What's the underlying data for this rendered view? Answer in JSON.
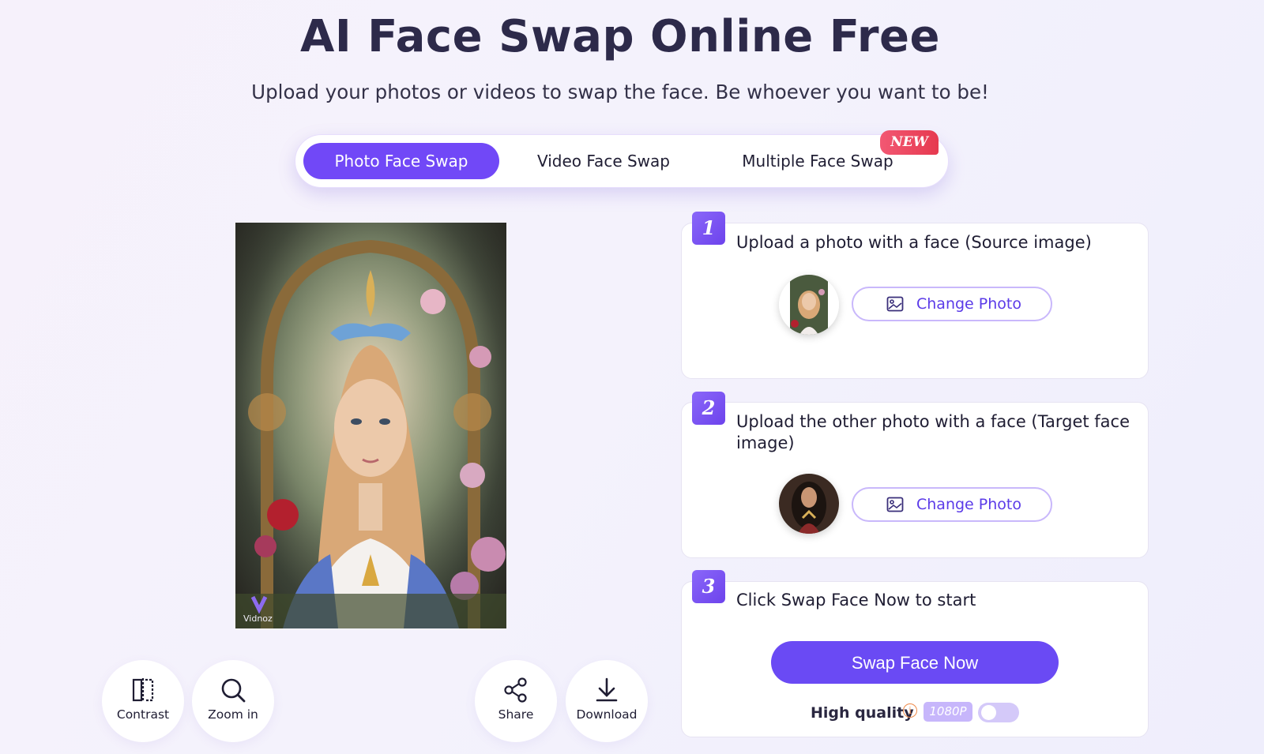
{
  "page": {
    "title": "AI Face Swap Online Free",
    "subtitle": "Upload your photos or videos to swap the face. Be whoever you want to be!"
  },
  "tabs": [
    {
      "label": "Photo Face Swap",
      "active": true
    },
    {
      "label": "Video Face Swap",
      "active": false
    },
    {
      "label": "Multiple Face Swap",
      "active": false
    }
  ],
  "new_badge": "NEW",
  "preview": {
    "watermark": "Vidnoz"
  },
  "tools": {
    "contrast": "Contrast",
    "zoom": "Zoom in",
    "share": "Share",
    "download": "Download"
  },
  "steps": [
    {
      "number": "1",
      "text": "Upload a photo with a face (Source image)",
      "button": "Change Photo"
    },
    {
      "number": "2",
      "text": "Upload the other photo with a face (Target face image)",
      "button": "Change Photo"
    },
    {
      "number": "3",
      "text": "Click Swap Face Now to start",
      "button": "Swap Face Now"
    }
  ],
  "quality": {
    "label": "High quality",
    "info": "i",
    "resolution": "1080P",
    "enabled": false
  },
  "colors": {
    "accent": "#6a4af4",
    "badge": "#e6394f",
    "title": "#2d2a4a"
  },
  "icons": [
    "contrast-icon",
    "search-icon",
    "share-icon",
    "download-icon",
    "image-icon",
    "info-icon"
  ]
}
